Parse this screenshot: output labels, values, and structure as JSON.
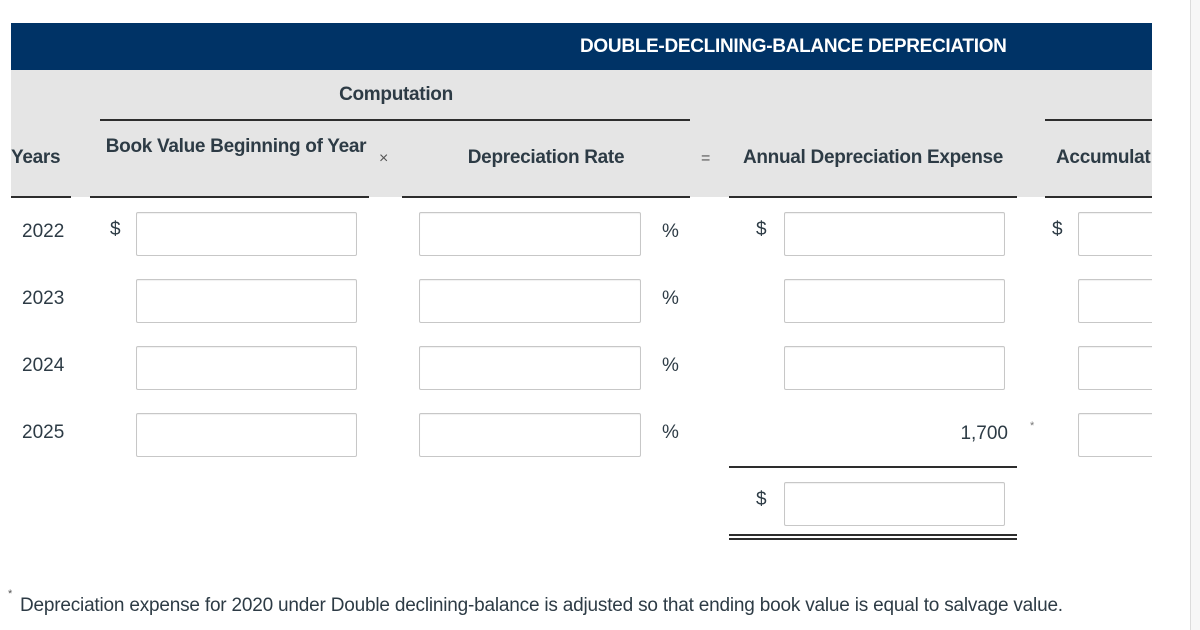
{
  "title": "DOUBLE-DECLINING-BALANCE DEPRECIATION",
  "group_header": "Computation",
  "columns": {
    "years": "Years",
    "book_value": "Book Value Beginning of Year",
    "times_op": "×",
    "rate": "Depreciation Rate",
    "equals_op": "=",
    "annual": "Annual Depreciation Expense",
    "accumulated": "Accumulat"
  },
  "currency_symbol": "$",
  "percent_symbol": "%",
  "rows": [
    {
      "year": "2022",
      "book_value": "",
      "rate": "",
      "annual": "",
      "accumulated": ""
    },
    {
      "year": "2023",
      "book_value": "",
      "rate": "",
      "annual": "",
      "accumulated": ""
    },
    {
      "year": "2024",
      "book_value": "",
      "rate": "",
      "annual": "",
      "accumulated": ""
    },
    {
      "year": "2025",
      "book_value": "",
      "rate": "",
      "annual_fixed": "1,700",
      "annual_note_marker": "*",
      "accumulated": ""
    }
  ],
  "total": {
    "annual_total": ""
  },
  "footnote": {
    "marker": "*",
    "text": "Depreciation expense for 2020 under Double declining-balance is adjusted so that ending book value is equal to salvage value."
  },
  "colors": {
    "header_bg": "#003366",
    "subheader_bg": "#e5e5e5",
    "text": "#2d3b45"
  }
}
